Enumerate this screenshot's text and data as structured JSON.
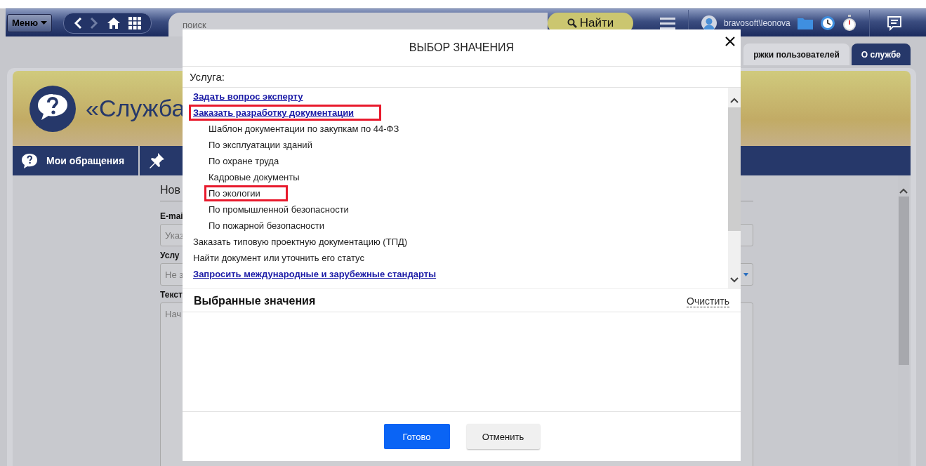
{
  "navbar": {
    "menu_button": "Меню",
    "search": {
      "placeholder": "поиск"
    },
    "search_button": "Найти",
    "user": "bravosoft\\leonova"
  },
  "tabs": [
    {
      "label": "ржки пользователей",
      "selected": false
    },
    {
      "label": "О службе",
      "selected": true
    }
  ],
  "header": {
    "title": "«Служба"
  },
  "nav_item": "Мои обращения",
  "form": {
    "heading": "Нов",
    "fields": [
      {
        "label": "E-mai",
        "placeholder": "Указ",
        "kind": "input"
      },
      {
        "label": "Услу",
        "placeholder": "Не з",
        "kind": "select"
      },
      {
        "label": "Текст",
        "placeholder": "Нач",
        "kind": "textarea"
      }
    ]
  },
  "dialog": {
    "title": "ВЫБОР ЗНАЧЕНИЯ",
    "field_label": "Услуга:",
    "options": [
      {
        "label": "Задать вопрос эксперту",
        "kind": "link",
        "highlighted": false
      },
      {
        "label": "Заказать разработку документации",
        "kind": "link",
        "highlighted": true,
        "children": [
          {
            "label": "Шаблон документации по закупкам по 44-ФЗ",
            "kind": "plain",
            "highlighted": false
          },
          {
            "label": "По эксплуатации зданий",
            "kind": "plain",
            "highlighted": false
          },
          {
            "label": "По охране труда",
            "kind": "plain",
            "highlighted": false
          },
          {
            "label": "Кадровые документы",
            "kind": "plain",
            "highlighted": false
          },
          {
            "label": "По экологии",
            "kind": "plain",
            "highlighted": true
          },
          {
            "label": "По промышленной безопасности",
            "kind": "plain",
            "highlighted": false
          },
          {
            "label": "По пожарной безопасности",
            "kind": "plain",
            "highlighted": false
          }
        ]
      },
      {
        "label": "Заказать типовую проектную документацию (ТПД)",
        "kind": "plain",
        "highlighted": false
      },
      {
        "label": "Найти документ или уточнить его статус",
        "kind": "plain",
        "highlighted": false
      },
      {
        "label": "Запросить международные и зарубежные стандарты",
        "kind": "link",
        "highlighted": false
      }
    ],
    "selected_title": "Выбранные значения",
    "clear_link": "Очистить",
    "buttons": [
      {
        "label": "Готово",
        "kind": "primary"
      },
      {
        "label": "Отменить",
        "kind": "secondary"
      }
    ]
  }
}
